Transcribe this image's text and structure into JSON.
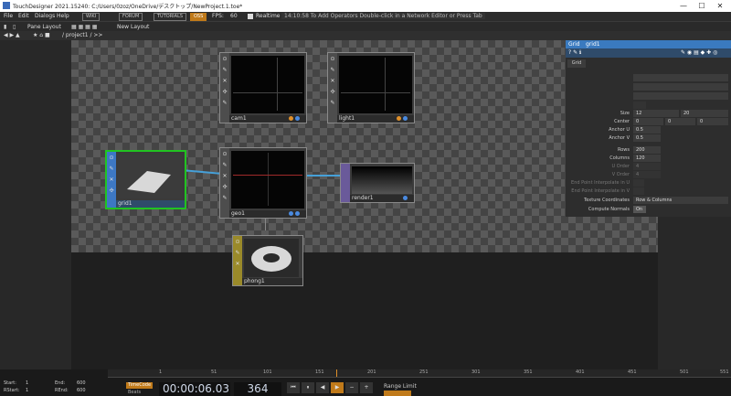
{
  "window": {
    "title": "TouchDesigner 2021.15240: C:/Users/0zoz/OneDrive/デスクトップ/NewProject.1.toe*",
    "min": "—",
    "max": "☐",
    "close": "✕"
  },
  "menubar": {
    "items": [
      "File",
      "Edit",
      "Dialogs",
      "Help"
    ],
    "tags": [
      "WIKI",
      "FORUM",
      "TUTORIALS"
    ],
    "oculus": "OSS",
    "fps_label": "FPS:",
    "fps": "60",
    "realtime": "Realtime",
    "hint": "14:10:58 To Add Operators Double-click in a Network Editor or Press Tab"
  },
  "toolbar": {
    "pane_layout": "Pane Layout",
    "new_layout": "New Layout"
  },
  "pathbar": {
    "path": "/ project1 / >>"
  },
  "nodes": {
    "cam1": "cam1",
    "light1": "light1",
    "grid1": "grid1",
    "geo1": "geo1",
    "render1": "render1",
    "phong1": "phong1"
  },
  "params": {
    "op_type": "Grid",
    "op_name": "grid1",
    "page_tab": "Grid",
    "rows": "200",
    "size_label": "Size",
    "size_x": "12",
    "size_y": "20",
    "center_label": "Center",
    "center_x": "0",
    "center_y": "0",
    "center_z": "0",
    "anchor_u_label": "Anchor U",
    "anchor_u": "0.5",
    "anchor_v_label": "Anchor V",
    "anchor_v": "0.5",
    "rows_label": "Rows",
    "columns_label": "Columns",
    "columns": "120",
    "u_order_label": "U Order",
    "u_order": "4",
    "v_order_label": "V Order",
    "v_order": "4",
    "endu_label": "End Point Interpolate in U",
    "endv_label": "End Point Interpolate in V",
    "texcoord_label": "Texture Coordinates",
    "texcoord": "Row & Columns",
    "normals_label": "Compute Normals",
    "normals": "On"
  },
  "timeline": {
    "start_label": "Start:",
    "start": "1",
    "end_label": "End:",
    "end": "600",
    "rstart_label": "RStart:",
    "rstart": "1",
    "rend_label": "REnd:",
    "rend": "600",
    "timecode_btn": "TimeCode",
    "beats_btn": "Beats",
    "timecode": "00:00:06.03",
    "frame": "364",
    "range_limit": "Range Limit",
    "ticks": [
      "1",
      "51",
      "101",
      "151",
      "201",
      "251",
      "301",
      "351",
      "401",
      "451",
      "501",
      "551"
    ]
  },
  "colors": {
    "accent": "#3a7abf",
    "selected": "#21c321",
    "wire": "#46a0d8"
  }
}
